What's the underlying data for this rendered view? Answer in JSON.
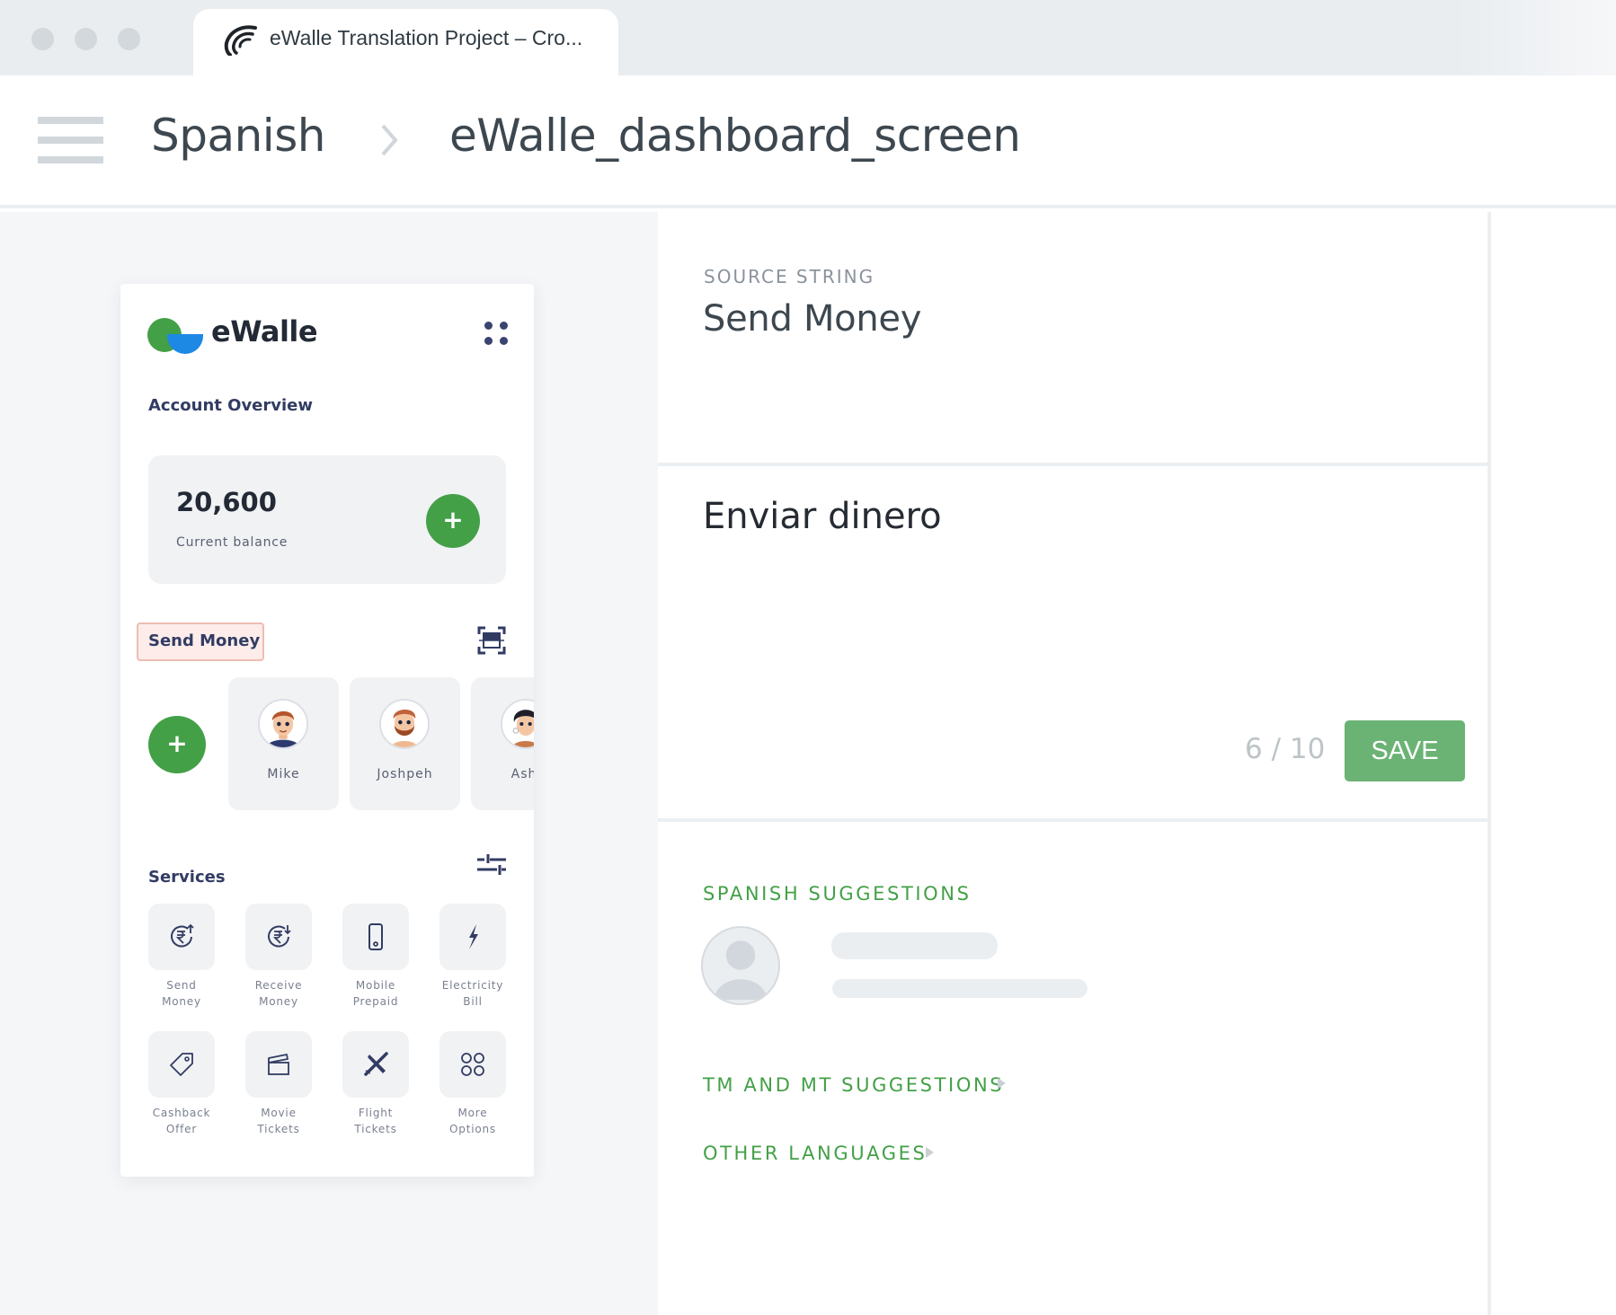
{
  "browser": {
    "tab_title": "eWalle Translation Project – Cro...",
    "tab_icon": "crowdin-logo-icon"
  },
  "header": {
    "menu_icon": "hamburger-menu-icon",
    "breadcrumb": [
      {
        "label": "Spanish"
      },
      {
        "label": "eWalle_dashboard_screen"
      }
    ],
    "separator_icon": "chevron-right-icon"
  },
  "preview": {
    "brand": "eWalle",
    "account_overview_title": "Account Overview",
    "balance_value": "20,600",
    "balance_label": "Current balance",
    "send_money_title": "Send Money",
    "contacts": [
      {
        "name": "Mike"
      },
      {
        "name": "Joshpeh"
      },
      {
        "name": "Ashl"
      }
    ],
    "services_title": "Services",
    "services": [
      {
        "line1": "Send",
        "line2": "Money",
        "icon": "rupee-send-icon"
      },
      {
        "line1": "Receive",
        "line2": "Money",
        "icon": "rupee-receive-icon"
      },
      {
        "line1": "Mobile",
        "line2": "Prepaid",
        "icon": "mobile-phone-icon"
      },
      {
        "line1": "Electricity",
        "line2": "Bill",
        "icon": "lightning-icon"
      },
      {
        "line1": "Cashback",
        "line2": "Offer",
        "icon": "price-tag-icon"
      },
      {
        "line1": "Movie",
        "line2": "Tickets",
        "icon": "clapperboard-icon"
      },
      {
        "line1": "Flight",
        "line2": "Tickets",
        "icon": "airplane-icon"
      },
      {
        "line1": "More",
        "line2": "Options",
        "icon": "more-options-icon"
      }
    ],
    "colors": {
      "green": "#43a047",
      "blue": "#1e88e5",
      "navy": "#323c63",
      "highlight_bg": "#fdecea"
    }
  },
  "editor": {
    "source_label": "SOURCE STRING",
    "source_text": "Send Money",
    "translation_value": "Enviar dinero",
    "char_counter": "6 / 10",
    "save_label": "SAVE",
    "spanish_suggestions_label": "SPANISH SUGGESTIONS",
    "tm_mt_label": "TM AND MT SUGGESTIONS",
    "other_languages_label": "OTHER LANGUAGES",
    "colors": {
      "accent_green": "#43a047",
      "save_button": "#6bb374"
    }
  }
}
